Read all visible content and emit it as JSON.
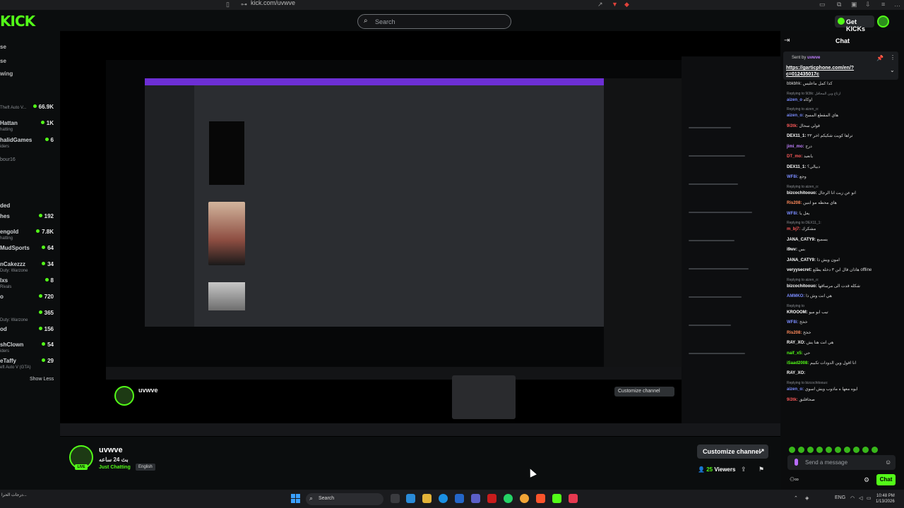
{
  "browser": {
    "url": "kick.com/uvwve"
  },
  "header": {
    "logo": "KICK",
    "search_placeholder": "Search",
    "get_kicks": "Get KICKs"
  },
  "sidebar": {
    "items": [
      {
        "name": "Theft Auto V...",
        "count": "66.9K"
      },
      {
        "name": "Hattan",
        "sub": "hatting",
        "count": "1K"
      },
      {
        "name": "halidGames",
        "sub": "iders",
        "count": "6"
      },
      {
        "name": "bour16",
        "sub": ""
      },
      {
        "name": "ded",
        "sub": ""
      },
      {
        "name": "hes",
        "count": "192"
      },
      {
        "name": "engold",
        "sub": "hatting",
        "count": "7.8K"
      },
      {
        "name": "MudSports",
        "count": "64"
      },
      {
        "name": "nCakezzz",
        "sub": "Duty: Warzone",
        "count": "34"
      },
      {
        "name": "lxs",
        "sub": "Rivals",
        "count": "8"
      },
      {
        "name": "o",
        "count": "720"
      },
      {
        "name": "",
        "count": "365"
      },
      {
        "name": "od",
        "sub": "Duty: Warzone",
        "count": "156"
      },
      {
        "name": "shClown",
        "sub": "iders",
        "count": "54"
      },
      {
        "name": "eTaffy",
        "sub": "eft Auto V (GTA)",
        "count": "29"
      }
    ],
    "show_less": "Show Less"
  },
  "channel": {
    "name": "uvwve",
    "title": "بث 24 ساعه",
    "category": "Just Chatting",
    "language": "English",
    "live_badge": "LIVE",
    "customize_label": "Customize channel",
    "viewers_count": "25",
    "viewers_label": "Viewers"
  },
  "nested": {
    "customize_label": "Customize channel",
    "name": "uvwve"
  },
  "chat": {
    "title": "Chat",
    "pinned_sent_by": "Sent by",
    "pinned_user": "uvwve",
    "pinned_link": "https://garticphone.com/en/?c=012435017c",
    "messages": [
      {
        "user": "",
        "text": "bbkbhk: كذا كمل ماعليس",
        "color": "#dddddd"
      },
      {
        "reply": "Replying to 9i3tk: ارتاع وين المحاقل"
      },
      {
        "user": "aizen_o",
        "text": "اوكاه",
        "color": "#7a8cff"
      },
      {
        "reply": "Replying to aizen_o:"
      },
      {
        "user": "aizen_o:",
        "text": "هاي المقطع المسح",
        "color": "#7a8cff"
      },
      {
        "user": "9i3tk:",
        "text": "قولي سحال",
        "color": "#ff5a5a"
      },
      {
        "user": "DEX11_1:",
        "text": "تراها كويت شكيكم اخر ٣٣",
        "color": "#ffffff"
      },
      {
        "user": "jimi_mo:",
        "text": "درج",
        "color": "#c07fff"
      },
      {
        "user": "DT_mo:",
        "text": "يانعيد",
        "color": "#ff5a5a"
      },
      {
        "user": "DEX11_1:",
        "text": "دبيالي؟",
        "color": "#ffffff"
      },
      {
        "user": "WF8i:",
        "text": "وجع",
        "color": "#7a8cff"
      },
      {
        "reply": "Replying to aizen_o:"
      },
      {
        "user": "bizcochitoouo:",
        "text": "انو عن زيت انا الرجال",
        "color": "#ffffff"
      },
      {
        "user": "Ris208:",
        "text": "هاي محطه مو ابنين",
        "color": "#ff8a5a"
      },
      {
        "user": "WF8i:",
        "text": "يعل يا",
        "color": "#7a8cff"
      },
      {
        "reply": "Replying to DEX11_1:"
      },
      {
        "user": "m_bj7:",
        "text": "مشكرك",
        "color": "#ff5a5a"
      },
      {
        "user": "JANA_CATY9:",
        "text": "يسميع",
        "color": "#ffffff"
      },
      {
        "user": "i9wv:",
        "text": "بس",
        "color": "#ffffff"
      },
      {
        "user": "JANA_CATY9:",
        "text": "امون ويش ذا",
        "color": "#ffffff"
      },
      {
        "user": "veryysecret:",
        "text": "هاذان قال ابن ٣ دخلة يطلع offline",
        "color": "#ffffff"
      },
      {
        "reply": "Replying to aizen_o:"
      },
      {
        "user": "bizcochitoouo:",
        "text": "شكله قدت الى مرساقها",
        "color": "#ffffff"
      },
      {
        "user": "AMMKO:",
        "text": "هي انت وش ذا",
        "color": "#7a8cff"
      },
      {
        "reply": "Replying to"
      },
      {
        "user": "KROOOM:",
        "text": "تيب ابو ميو",
        "color": "#ffffff"
      },
      {
        "user": "WF8i:",
        "text": "خخخ",
        "color": "#7a8cff"
      },
      {
        "user": "Ris208:",
        "text": "خخخ",
        "color": "#ff8a5a"
      },
      {
        "user": "RAY_XO:",
        "text": "هي انت هنا يش",
        "color": "#ffffff"
      },
      {
        "user": "naif_x5:",
        "text": "حي",
        "color": "#53fc18"
      },
      {
        "user": "iSaad2008:",
        "text": "انا اقول وين الدودات تكبيم",
        "color": "#53fc18"
      },
      {
        "user": "RAY_XO:",
        "text": "",
        "color": "#ffffff"
      },
      {
        "reply": "Replying to bizcochitoouo:"
      },
      {
        "user": "aizen_o:",
        "text": "ايوه معها ه مادوب ويش اسوي",
        "color": "#7a8cff"
      },
      {
        "user": "9i3tk:",
        "text": "صحافلنق",
        "color": "#ff5a5a"
      }
    ],
    "send_placeholder": "Send a message",
    "chat_button": "Chat"
  },
  "taskbar": {
    "weather": "درجات الحرا...",
    "search_placeholder": "Search",
    "lang": "ENG",
    "time": "10:48 PM",
    "date": "1/13/2026"
  },
  "colors": {
    "accent": "#53fc18",
    "purple": "#6d2fd5"
  }
}
